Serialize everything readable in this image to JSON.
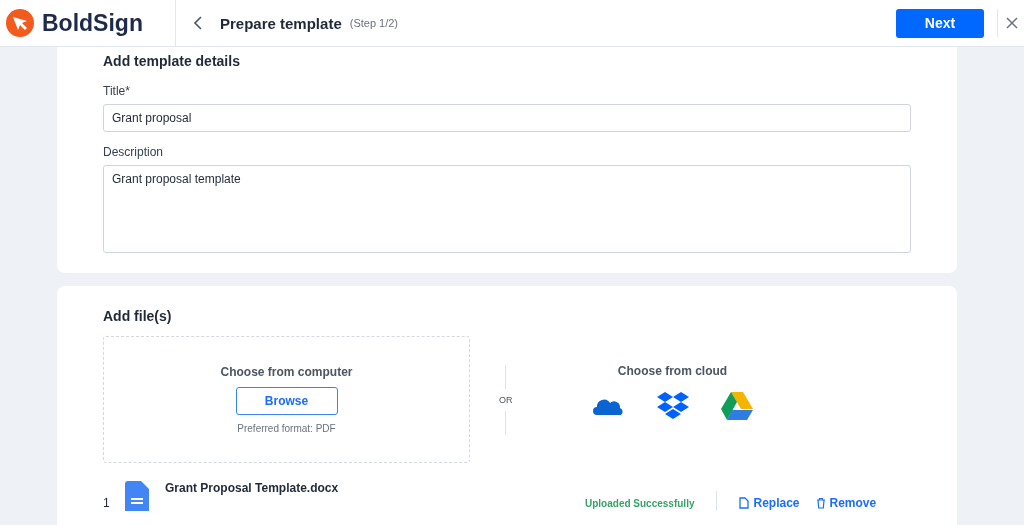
{
  "header": {
    "brand": "BoldSign",
    "title": "Prepare template",
    "step": "(Step 1/2)",
    "next_button": "Next"
  },
  "details": {
    "heading": "Add template details",
    "title_label": "Title*",
    "title_value": "Grant proposal",
    "description_label": "Description",
    "description_value": "Grant proposal template"
  },
  "files": {
    "heading": "Add file(s)",
    "computer": {
      "label": "Choose from computer",
      "button": "Browse",
      "hint": "Preferred format: PDF"
    },
    "or": "OR",
    "cloud": {
      "label": "Choose from cloud",
      "providers": [
        {
          "kind": "onedrive"
        },
        {
          "kind": "dropbox"
        },
        {
          "kind": "drive"
        }
      ]
    },
    "items": [
      {
        "index": "1",
        "name": "Grant Proposal Template.docx",
        "status": "Uploaded Successfully",
        "actions": [
          {
            "kind": "replace",
            "label": "Replace"
          },
          {
            "kind": "remove",
            "label": "Remove"
          }
        ]
      }
    ]
  }
}
